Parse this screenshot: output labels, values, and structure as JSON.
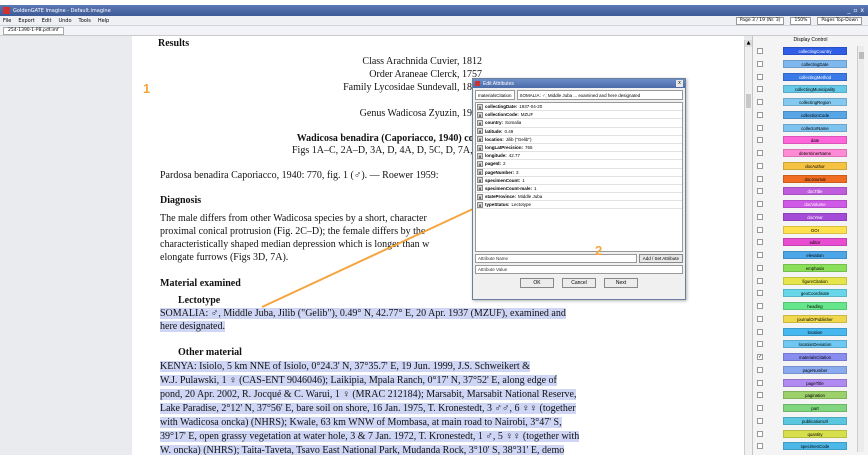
{
  "window": {
    "title": "GoldenGATE Imagine - Default.imagine",
    "minimize": "_",
    "restore": "▫",
    "close": "x"
  },
  "menu": {
    "items": [
      "File",
      "Export",
      "Edit",
      "Undo",
      "Tools",
      "Help"
    ],
    "page_indicator": "Page 3 / 19 (Nr. 3)",
    "zoom": "150%",
    "layout": "Pages Top-Down"
  },
  "document": {
    "tab": "254-1390-1-PB.pdf.imf"
  },
  "page": {
    "lines": [
      {
        "text": "Results",
        "bold": true,
        "highlight": false
      },
      {
        "text": "Class Arachnida Cuvier, 1812",
        "bold": false,
        "highlight": false
      },
      {
        "text": "Order Araneae Clerck, 1757",
        "bold": false,
        "highlight": false
      },
      {
        "text": "Family Lycosidae Sundevall, 1833",
        "bold": false,
        "highlight": false
      },
      {
        "text": "Genus Wadicosa Zyuzin, 1985",
        "bold": false,
        "highlight": false
      },
      {
        "text": "Wadicosa benadira (Caporiacco, 1940) com",
        "bold": true,
        "highlight": false
      },
      {
        "text": "Figs 1A–C, 2A–D, 3A, D, 4A, D, 5C, D, 7A, 8A,",
        "bold": false,
        "highlight": false
      },
      {
        "text": "Pardosa benadira Caporiacco, 1940: 770, fig. 1 (♂). — Roewer 1959:",
        "bold": false,
        "highlight": false
      },
      {
        "text": "Diagnosis",
        "bold": true,
        "highlight": false
      },
      {
        "text": "The male differs from other Wadicosa species by a short, character",
        "bold": false,
        "highlight": false
      },
      {
        "text": "proximal conical protrusion (Fig. 2C–D); the female differs by the",
        "bold": false,
        "highlight": false
      },
      {
        "text": "characteristically shaped median depression which is longer than w",
        "bold": false,
        "highlight": false
      },
      {
        "text": "elongate furrows (Figs 3D, 7A).",
        "bold": false,
        "highlight": false
      },
      {
        "text": "Material examined",
        "bold": true,
        "highlight": false
      },
      {
        "text": "Lectotype",
        "bold": true,
        "highlight": false
      },
      {
        "text": "SOMALIA: ♂, Middle Juba, Jilib (\"Gelib\"), 0.49° N, 42.77° E, 20 Apr. 1937 (MZUF), examined and",
        "bold": false,
        "highlight": true
      },
      {
        "text": "here designated.",
        "bold": false,
        "highlight": true
      },
      {
        "text": "Other material",
        "bold": true,
        "highlight": false
      },
      {
        "text": "KENYA: Isiolo, 5 km NNE of Isiolo, 0°24.3' N, 37°35.7' E, 19 Jun. 1999, J.S. Schweikert &",
        "bold": false,
        "highlight": true
      },
      {
        "text": "W.J. Pulawski, 1 ♀ (CAS-ENT 9046046); Laikipia, Mpala Ranch, 0°17' N, 37°52' E, along edge of",
        "bold": false,
        "highlight": true
      },
      {
        "text": "pond, 20 Apr. 2002, R. Jocqué & C. Warui, 1 ♀ (MRAC 212184); Marsabit, Marsabit National Reserve,",
        "bold": false,
        "highlight": true
      },
      {
        "text": "Lake Paradise, 2°12' N, 37°56' E, bare soil on shore, 16 Jan. 1975, T. Kronestedt, 3 ♂♂, 6 ♀♀ (together",
        "bold": false,
        "highlight": true
      },
      {
        "text": "with Wadicosa oncka) (NHRS); Kwale, 63 km WNW of Mombasa, at main road to Nairobi, 3°47' S,",
        "bold": false,
        "highlight": true
      },
      {
        "text": "39°17' E, open grassy vegetation at water hole, 3 & 7 Jan. 1972, T. Kronestedt, 1 ♂, 5 ♀♀ (together with",
        "bold": false,
        "highlight": true
      },
      {
        "text": "W. oncka) (NHRS); Taita-Taveta, Tsavo East National Park, Mudanda Rock, 3°10' S, 38°31' E, demo",
        "bold": false,
        "highlight": true
      }
    ]
  },
  "annotations": {
    "label1": "1",
    "label2": "2"
  },
  "dialog": {
    "title": "Edit Attributes",
    "summary_key": "materialsCitation",
    "summary_value": "SOMALIA: ♂, Middle Juba ... examined and here designated",
    "attributes": [
      {
        "name": "collectingDate:",
        "value": "1937-04-20"
      },
      {
        "name": "collectionCode:",
        "value": "MZUF"
      },
      {
        "name": "country:",
        "value": "Somalia"
      },
      {
        "name": "latitude:",
        "value": "0.49"
      },
      {
        "name": "location:",
        "value": "Jilib (\"Gelib\")"
      },
      {
        "name": "longLatPrecision:",
        "value": "765"
      },
      {
        "name": "longitude:",
        "value": "42.77"
      },
      {
        "name": "pageId:",
        "value": "2"
      },
      {
        "name": "pageNumber:",
        "value": "3"
      },
      {
        "name": "specimenCount:",
        "value": "1"
      },
      {
        "name": "specimenCount-male:",
        "value": "1"
      },
      {
        "name": "stateProvince:",
        "value": "Middle Juba"
      },
      {
        "name": "typeStatus:",
        "value": "Lectotype"
      }
    ],
    "remove_glyph": "X",
    "attr_name_placeholder": "Attribute Name",
    "attr_value_placeholder": "Attribute Value",
    "add_set_label": "Add / Set Attribute",
    "ok_label": "OK",
    "cancel_label": "Cancel",
    "next_label": "Next"
  },
  "panel": {
    "title": "Display Control",
    "items": [
      {
        "label": "collectingCountry",
        "color": "#2f5de6",
        "text_color": "#ffffff",
        "checked": false
      },
      {
        "label": "collectingDate",
        "color": "#7fb8ee",
        "text_color": "#000000",
        "checked": false
      },
      {
        "label": "collectingMethod",
        "color": "#3a7ae8",
        "text_color": "#ffffff",
        "checked": false
      },
      {
        "label": "collectingMunicipality",
        "color": "#66c9e8",
        "text_color": "#000000",
        "checked": false
      },
      {
        "label": "collectingRegion",
        "color": "#84c9ef",
        "text_color": "#000000",
        "checked": false
      },
      {
        "label": "collectionCode",
        "color": "#58a6e6",
        "text_color": "#000000",
        "checked": false
      },
      {
        "label": "collectorName",
        "color": "#7ec2f0",
        "text_color": "#000000",
        "checked": false
      },
      {
        "label": "date",
        "color": "#ff66d9",
        "text_color": "#000000",
        "checked": false
      },
      {
        "label": "determinerName",
        "color": "#ff8ad6",
        "text_color": "#000000",
        "checked": false
      },
      {
        "label": "docAuthor",
        "color": "#f5c242",
        "text_color": "#000000",
        "checked": false
      },
      {
        "label": "docJournal",
        "color": "#f06c22",
        "text_color": "#000000",
        "checked": false
      },
      {
        "label": "docTitle",
        "color": "#c05dde",
        "text_color": "#ffffff",
        "checked": false
      },
      {
        "label": "docVolume",
        "color": "#d05ae8",
        "text_color": "#ffffff",
        "checked": false
      },
      {
        "label": "docYear",
        "color": "#a44cd8",
        "text_color": "#ffffff",
        "checked": false
      },
      {
        "label": "DOI",
        "color": "#ffe14d",
        "text_color": "#000000",
        "checked": false
      },
      {
        "label": "editor",
        "color": "#e84cd0",
        "text_color": "#000000",
        "checked": false
      },
      {
        "label": "elevation",
        "color": "#4ca6e8",
        "text_color": "#000000",
        "checked": false
      },
      {
        "label": "emphasis",
        "color": "#8be05a",
        "text_color": "#000000",
        "checked": false
      },
      {
        "label": "figureCitation",
        "color": "#e6e64c",
        "text_color": "#000000",
        "checked": false
      },
      {
        "label": "geoCoordinate",
        "color": "#66d6e8",
        "text_color": "#000000",
        "checked": false
      },
      {
        "label": "heading",
        "color": "#66e68a",
        "text_color": "#000000",
        "checked": false
      },
      {
        "label": "journalOrPublisher",
        "color": "#f0d84c",
        "text_color": "#000000",
        "checked": false
      },
      {
        "label": "location",
        "color": "#48b8f0",
        "text_color": "#000000",
        "checked": false
      },
      {
        "label": "locationDeviation",
        "color": "#6ec8f2",
        "text_color": "#000000",
        "checked": false
      },
      {
        "label": "materialsCitation",
        "color": "#8a8df0",
        "text_color": "#000000",
        "checked": true
      },
      {
        "label": "pageNumber",
        "color": "#8aaaf0",
        "text_color": "#000000",
        "checked": false
      },
      {
        "label": "pageTitle",
        "color": "#b08af0",
        "text_color": "#000000",
        "checked": false
      },
      {
        "label": "pagination",
        "color": "#9bd06a",
        "text_color": "#000000",
        "checked": false
      },
      {
        "label": "part",
        "color": "#7fd67f",
        "text_color": "#000000",
        "checked": false
      },
      {
        "label": "publicationUrl",
        "color": "#5ac6e0",
        "text_color": "#000000",
        "checked": false
      },
      {
        "label": "quantity",
        "color": "#d7e04c",
        "text_color": "#000000",
        "checked": false
      },
      {
        "label": "specimenCode",
        "color": "#4cb8e8",
        "text_color": "#000000",
        "checked": false
      }
    ]
  }
}
